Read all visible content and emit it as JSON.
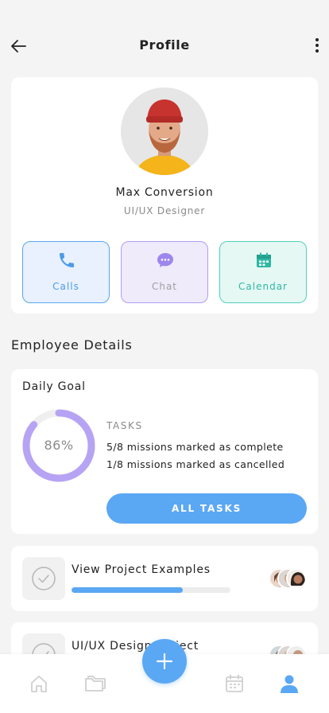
{
  "header": {
    "title": "Profile",
    "back_icon": "arrow-left-icon",
    "more_icon": "more-vertical-icon"
  },
  "profile": {
    "name": "Max Conversion",
    "role": "UI/UX Designer",
    "actions": [
      {
        "label": "Calls",
        "icon": "phone-icon",
        "color": "#4c9be8"
      },
      {
        "label": "Chat",
        "icon": "chat-bubble-icon",
        "color": "#9d86ec"
      },
      {
        "label": "Calendar",
        "icon": "calendar-icon",
        "color": "#2eb8a3"
      }
    ]
  },
  "employee_details": {
    "section_title": "Employee Details",
    "daily_goal": {
      "title": "Daily Goal",
      "percent_label": "86%",
      "percent": 0.86,
      "tasks_label": "TASKS",
      "line_1": "5/8 missions marked as complete",
      "line_2": "1/8 missions marked as cancelled",
      "button_label": "ALL TASKS"
    }
  },
  "projects": [
    {
      "title": "View Project Examples",
      "progress": 0.7
    },
    {
      "title": "UI/UX Design Project"
    }
  ],
  "bottom_nav": {
    "items": [
      "home-icon",
      "folder-icon",
      "calendar-icon",
      "user-icon"
    ],
    "fab_icon": "plus-icon"
  },
  "colors": {
    "accent": "#5aa7f4",
    "ring": "#b7a3f3",
    "teal": "#4fd1bd"
  }
}
